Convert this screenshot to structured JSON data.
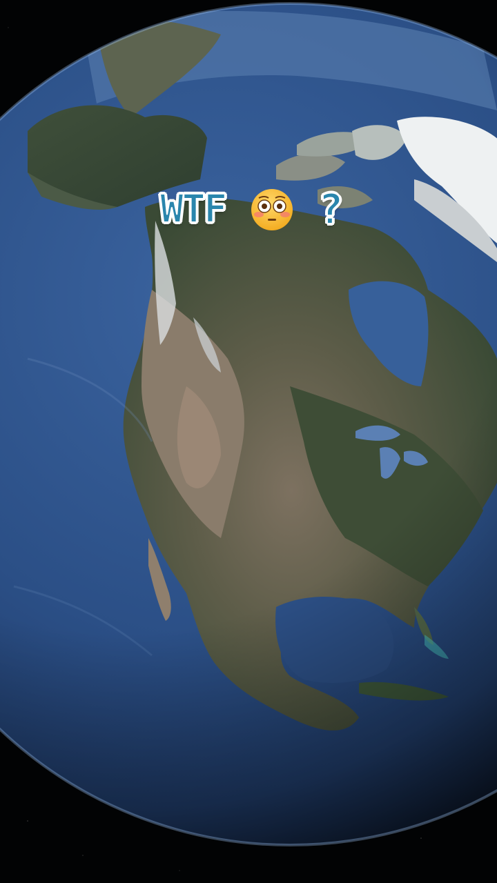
{
  "caption": {
    "word": "WTF",
    "emoji_icon": "flushed-face-icon",
    "punctuation": "?"
  },
  "colors": {
    "caption_fill": "#2a86ad",
    "caption_outline": "#ffffff",
    "ocean": "#2b4f86",
    "space": "#030406"
  }
}
